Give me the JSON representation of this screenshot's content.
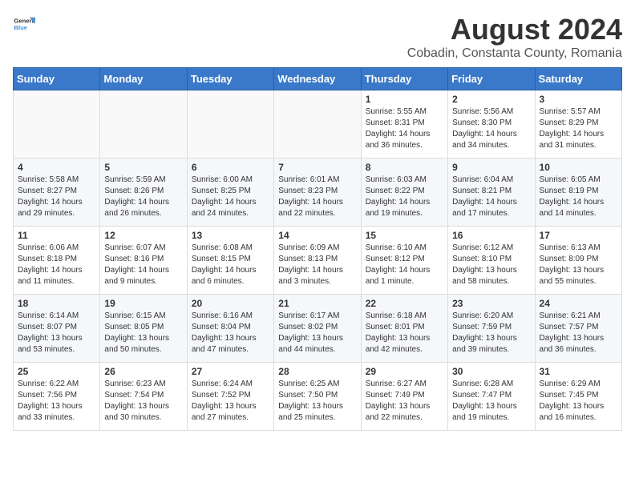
{
  "header": {
    "logo_general": "General",
    "logo_blue": "Blue",
    "title": "August 2024",
    "subtitle": "Cobadin, Constanta County, Romania"
  },
  "days_of_week": [
    "Sunday",
    "Monday",
    "Tuesday",
    "Wednesday",
    "Thursday",
    "Friday",
    "Saturday"
  ],
  "weeks": [
    [
      {
        "day": "",
        "sunrise": "",
        "sunset": "",
        "daylight": ""
      },
      {
        "day": "",
        "sunrise": "",
        "sunset": "",
        "daylight": ""
      },
      {
        "day": "",
        "sunrise": "",
        "sunset": "",
        "daylight": ""
      },
      {
        "day": "",
        "sunrise": "",
        "sunset": "",
        "daylight": ""
      },
      {
        "day": "1",
        "sunrise": "5:55 AM",
        "sunset": "8:31 PM",
        "daylight": "14 hours and 36 minutes."
      },
      {
        "day": "2",
        "sunrise": "5:56 AM",
        "sunset": "8:30 PM",
        "daylight": "14 hours and 34 minutes."
      },
      {
        "day": "3",
        "sunrise": "5:57 AM",
        "sunset": "8:29 PM",
        "daylight": "14 hours and 31 minutes."
      }
    ],
    [
      {
        "day": "4",
        "sunrise": "5:58 AM",
        "sunset": "8:27 PM",
        "daylight": "14 hours and 29 minutes."
      },
      {
        "day": "5",
        "sunrise": "5:59 AM",
        "sunset": "8:26 PM",
        "daylight": "14 hours and 26 minutes."
      },
      {
        "day": "6",
        "sunrise": "6:00 AM",
        "sunset": "8:25 PM",
        "daylight": "14 hours and 24 minutes."
      },
      {
        "day": "7",
        "sunrise": "6:01 AM",
        "sunset": "8:23 PM",
        "daylight": "14 hours and 22 minutes."
      },
      {
        "day": "8",
        "sunrise": "6:03 AM",
        "sunset": "8:22 PM",
        "daylight": "14 hours and 19 minutes."
      },
      {
        "day": "9",
        "sunrise": "6:04 AM",
        "sunset": "8:21 PM",
        "daylight": "14 hours and 17 minutes."
      },
      {
        "day": "10",
        "sunrise": "6:05 AM",
        "sunset": "8:19 PM",
        "daylight": "14 hours and 14 minutes."
      }
    ],
    [
      {
        "day": "11",
        "sunrise": "6:06 AM",
        "sunset": "8:18 PM",
        "daylight": "14 hours and 11 minutes."
      },
      {
        "day": "12",
        "sunrise": "6:07 AM",
        "sunset": "8:16 PM",
        "daylight": "14 hours and 9 minutes."
      },
      {
        "day": "13",
        "sunrise": "6:08 AM",
        "sunset": "8:15 PM",
        "daylight": "14 hours and 6 minutes."
      },
      {
        "day": "14",
        "sunrise": "6:09 AM",
        "sunset": "8:13 PM",
        "daylight": "14 hours and 3 minutes."
      },
      {
        "day": "15",
        "sunrise": "6:10 AM",
        "sunset": "8:12 PM",
        "daylight": "14 hours and 1 minute."
      },
      {
        "day": "16",
        "sunrise": "6:12 AM",
        "sunset": "8:10 PM",
        "daylight": "13 hours and 58 minutes."
      },
      {
        "day": "17",
        "sunrise": "6:13 AM",
        "sunset": "8:09 PM",
        "daylight": "13 hours and 55 minutes."
      }
    ],
    [
      {
        "day": "18",
        "sunrise": "6:14 AM",
        "sunset": "8:07 PM",
        "daylight": "13 hours and 53 minutes."
      },
      {
        "day": "19",
        "sunrise": "6:15 AM",
        "sunset": "8:05 PM",
        "daylight": "13 hours and 50 minutes."
      },
      {
        "day": "20",
        "sunrise": "6:16 AM",
        "sunset": "8:04 PM",
        "daylight": "13 hours and 47 minutes."
      },
      {
        "day": "21",
        "sunrise": "6:17 AM",
        "sunset": "8:02 PM",
        "daylight": "13 hours and 44 minutes."
      },
      {
        "day": "22",
        "sunrise": "6:18 AM",
        "sunset": "8:01 PM",
        "daylight": "13 hours and 42 minutes."
      },
      {
        "day": "23",
        "sunrise": "6:20 AM",
        "sunset": "7:59 PM",
        "daylight": "13 hours and 39 minutes."
      },
      {
        "day": "24",
        "sunrise": "6:21 AM",
        "sunset": "7:57 PM",
        "daylight": "13 hours and 36 minutes."
      }
    ],
    [
      {
        "day": "25",
        "sunrise": "6:22 AM",
        "sunset": "7:56 PM",
        "daylight": "13 hours and 33 minutes."
      },
      {
        "day": "26",
        "sunrise": "6:23 AM",
        "sunset": "7:54 PM",
        "daylight": "13 hours and 30 minutes."
      },
      {
        "day": "27",
        "sunrise": "6:24 AM",
        "sunset": "7:52 PM",
        "daylight": "13 hours and 27 minutes."
      },
      {
        "day": "28",
        "sunrise": "6:25 AM",
        "sunset": "7:50 PM",
        "daylight": "13 hours and 25 minutes."
      },
      {
        "day": "29",
        "sunrise": "6:27 AM",
        "sunset": "7:49 PM",
        "daylight": "13 hours and 22 minutes."
      },
      {
        "day": "30",
        "sunrise": "6:28 AM",
        "sunset": "7:47 PM",
        "daylight": "13 hours and 19 minutes."
      },
      {
        "day": "31",
        "sunrise": "6:29 AM",
        "sunset": "7:45 PM",
        "daylight": "13 hours and 16 minutes."
      }
    ]
  ]
}
